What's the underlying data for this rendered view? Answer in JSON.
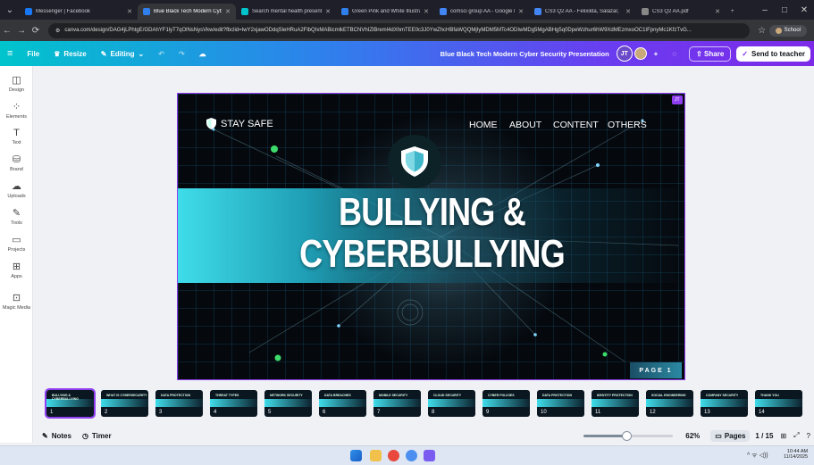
{
  "browser": {
    "tabs": [
      {
        "label": "Messenger | Facebook",
        "color": "#1877f2",
        "active": false
      },
      {
        "label": "Blue Black Tech Modern Cyber",
        "color": "#2f80ed",
        "active": true
      },
      {
        "label": "Search mental health presentati",
        "color": "#00c4cc",
        "active": false
      },
      {
        "label": "Green Pink and White Illustrati",
        "color": "#2f80ed",
        "active": false
      },
      {
        "label": "comsci group AA - Google Do",
        "color": "#4285f4",
        "active": false
      },
      {
        "label": "CS3 Q2 AA - Felixilda, Salazar,",
        "color": "#4285f4",
        "active": false
      },
      {
        "label": "CS3 Q2 AA.pdf",
        "color": "#888888",
        "active": false
      }
    ],
    "url": "canva.com/design/DAG4jLPhtgE/GDAhYF1lyT7qOlNsNysVkw/edit?fbclid=IwY2xjawODdqSleHRuA2FlbQIxMABicmlkETBCNVhIZlBreml4dXhmTEE0c3J0YwZhcHBfaWQQMjIyMDM5MTc4ODIwMDg5MgABHg5q0DpeWzhur6hW9XdMEzmxoOC1IFpnyMc1KfzTvG...",
    "profile_label": "School"
  },
  "editor": {
    "file_label": "File",
    "resize_label": "Resize",
    "editing_label": "Editing",
    "doc_title": "Blue Black Tech Modern Cyber Security Presentation",
    "avatar_initials": "JT",
    "share_label": "Share",
    "send_label": "Send to teacher"
  },
  "sidebar": [
    {
      "label": "Design",
      "icon": "◫",
      "name": "design"
    },
    {
      "label": "Elements",
      "icon": "⁘",
      "name": "elements"
    },
    {
      "label": "Text",
      "icon": "T",
      "name": "text"
    },
    {
      "label": "Brand",
      "icon": "⛁",
      "name": "brand"
    },
    {
      "label": "Uploads",
      "icon": "☁",
      "name": "uploads"
    },
    {
      "label": "Tools",
      "icon": "✎",
      "name": "tools"
    },
    {
      "label": "Projects",
      "icon": "▭",
      "name": "projects"
    },
    {
      "label": "Apps",
      "icon": "⊞",
      "name": "apps"
    },
    {
      "label": "Magic Media",
      "icon": "⊡",
      "name": "magic-media"
    }
  ],
  "slide": {
    "brand": "STAY SAFE",
    "nav": [
      "HOME",
      "ABOUT",
      "CONTENT",
      "OTHERS"
    ],
    "title_line1": "BULLYING &",
    "title_line2": "CYBERBULLYING",
    "page_label": "PAGE 1",
    "collab_tag": "JT"
  },
  "thumbnails": [
    {
      "num": "1",
      "caption": "BULLYING & CYBERBULLYING"
    },
    {
      "num": "2",
      "caption": "WHAT IS CYBERSECURITY"
    },
    {
      "num": "3",
      "caption": "DATA PROTECTION"
    },
    {
      "num": "4",
      "caption": "THREAT TYPES"
    },
    {
      "num": "5",
      "caption": "NETWORK SECURITY"
    },
    {
      "num": "6",
      "caption": "DATA BREACHES"
    },
    {
      "num": "7",
      "caption": "MOBILE SECURITY"
    },
    {
      "num": "8",
      "caption": "CLOUD SECURITY"
    },
    {
      "num": "9",
      "caption": "CYBER POLICIES"
    },
    {
      "num": "10",
      "caption": "DATA PROTECTION"
    },
    {
      "num": "11",
      "caption": "IDENTITY PROTECTION"
    },
    {
      "num": "12",
      "caption": "SOCIAL ENGINEERING"
    },
    {
      "num": "13",
      "caption": "COMPANY SECURITY"
    },
    {
      "num": "14",
      "caption": "THANK YOU"
    }
  ],
  "bottom_bar": {
    "notes_label": "Notes",
    "timer_label": "Timer",
    "zoom": "62%",
    "pages_label": "Pages",
    "page_count": "1 / 15"
  },
  "taskbar": {
    "time": "10:44 AM",
    "date": "11/14/2025"
  }
}
